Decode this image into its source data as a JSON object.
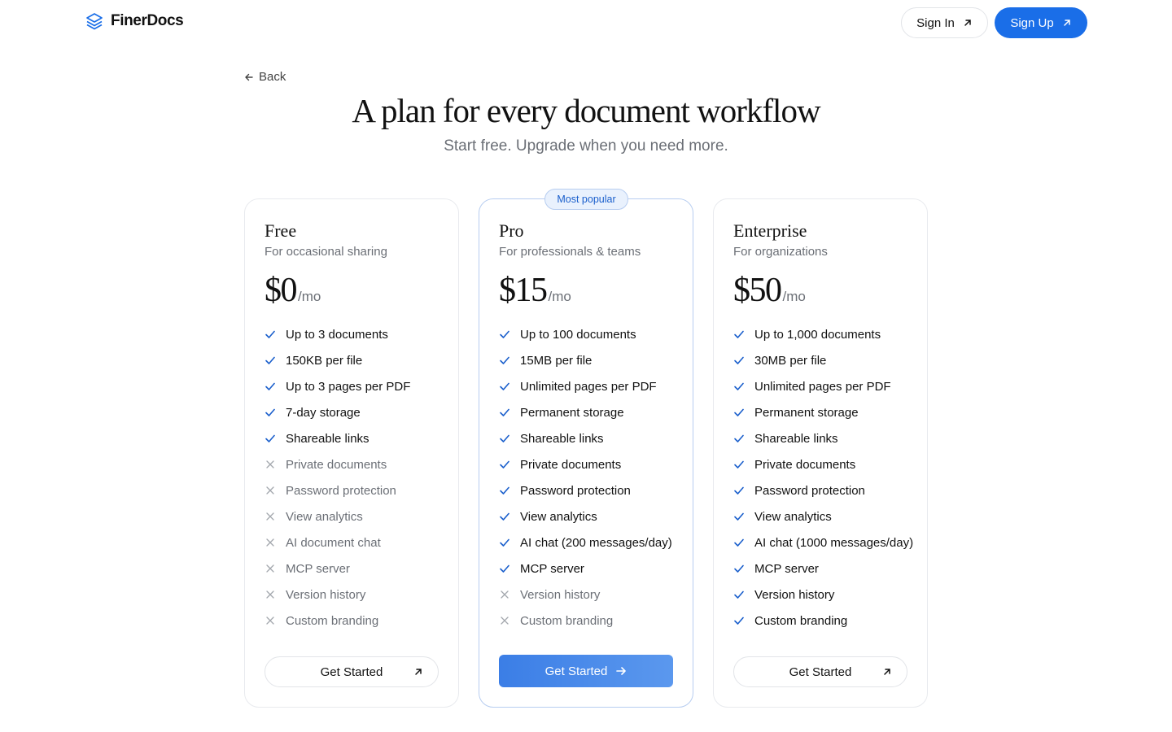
{
  "header": {
    "brand": "FinerDocs",
    "sign_in_label": "Sign In",
    "sign_up_label": "Sign Up"
  },
  "back_label": "Back",
  "title": "A plan for every document workflow",
  "subtitle": "Start free. Upgrade when you need more.",
  "colors": {
    "accent": "#1a6ee8",
    "check": "#1a5fcc",
    "muted": "#6b6f76"
  },
  "plans": [
    {
      "name": "Free",
      "description": "For occasional sharing",
      "price": "$0",
      "period": "/mo",
      "cta": "Get Started",
      "features": [
        {
          "text": "Up to 3 documents",
          "included": true
        },
        {
          "text": "150KB per file",
          "included": true
        },
        {
          "text": "Up to 3 pages per PDF",
          "included": true
        },
        {
          "text": "7-day storage",
          "included": true
        },
        {
          "text": "Shareable links",
          "included": true
        },
        {
          "text": "Private documents",
          "included": false
        },
        {
          "text": "Password protection",
          "included": false
        },
        {
          "text": "View analytics",
          "included": false
        },
        {
          "text": "AI document chat",
          "included": false
        },
        {
          "text": "MCP server",
          "included": false
        },
        {
          "text": "Version history",
          "included": false
        },
        {
          "text": "Custom branding",
          "included": false
        }
      ]
    },
    {
      "name": "Pro",
      "badge": "Most popular",
      "description": "For professionals & teams",
      "price": "$15",
      "period": "/mo",
      "cta": "Get Started",
      "features": [
        {
          "text": "Up to 100 documents",
          "included": true
        },
        {
          "text": "15MB per file",
          "included": true
        },
        {
          "text": "Unlimited pages per PDF",
          "included": true
        },
        {
          "text": "Permanent storage",
          "included": true
        },
        {
          "text": "Shareable links",
          "included": true
        },
        {
          "text": "Private documents",
          "included": true
        },
        {
          "text": "Password protection",
          "included": true
        },
        {
          "text": "View analytics",
          "included": true
        },
        {
          "text": "AI chat (200 messages/day)",
          "included": true
        },
        {
          "text": "MCP server",
          "included": true
        },
        {
          "text": "Version history",
          "included": false
        },
        {
          "text": "Custom branding",
          "included": false
        }
      ]
    },
    {
      "name": "Enterprise",
      "description": "For organizations",
      "price": "$50",
      "period": "/mo",
      "cta": "Get Started",
      "features": [
        {
          "text": "Up to 1,000 documents",
          "included": true
        },
        {
          "text": "30MB per file",
          "included": true
        },
        {
          "text": "Unlimited pages per PDF",
          "included": true
        },
        {
          "text": "Permanent storage",
          "included": true
        },
        {
          "text": "Shareable links",
          "included": true
        },
        {
          "text": "Private documents",
          "included": true
        },
        {
          "text": "Password protection",
          "included": true
        },
        {
          "text": "View analytics",
          "included": true
        },
        {
          "text": "AI chat (1000 messages/day)",
          "included": true
        },
        {
          "text": "MCP server",
          "included": true
        },
        {
          "text": "Version history",
          "included": true
        },
        {
          "text": "Custom branding",
          "included": true
        }
      ]
    }
  ]
}
